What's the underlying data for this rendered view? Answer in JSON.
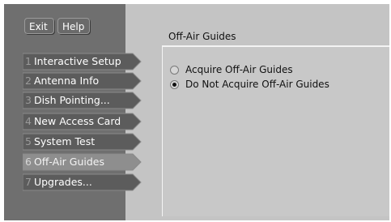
{
  "toolbar": {
    "exit_label": "Exit",
    "help_label": "Help"
  },
  "menu": {
    "items": [
      {
        "number": "1",
        "label": "Interactive Setup",
        "selected": false
      },
      {
        "number": "2",
        "label": "Antenna Info",
        "selected": false
      },
      {
        "number": "3",
        "label": "Dish Pointing...",
        "selected": false
      },
      {
        "number": "4",
        "label": "New Access Card",
        "selected": false
      },
      {
        "number": "5",
        "label": "System Test",
        "selected": false
      },
      {
        "number": "6",
        "label": "Off-Air Guides",
        "selected": true
      },
      {
        "number": "7",
        "label": "Upgrades...",
        "selected": false
      }
    ]
  },
  "panel": {
    "title": "Off-Air Guides",
    "options": [
      {
        "label": "Acquire Off-Air Guides",
        "checked": false
      },
      {
        "label": "Do Not Acquire Off-Air Guides",
        "checked": true
      }
    ]
  },
  "colors": {
    "sidebar_bg": "#6f6f6f",
    "content_bg": "#c4c4c4",
    "menu_item_bg": "#5c5c5c",
    "menu_item_selected_bg": "#8e8e8e"
  }
}
